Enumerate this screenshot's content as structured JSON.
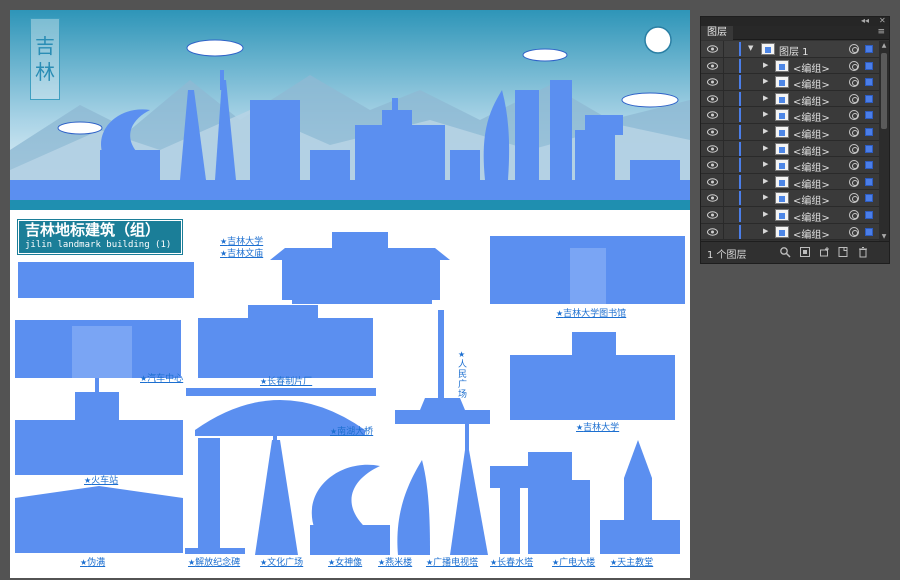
{
  "artboard": {
    "title_chars": [
      "吉",
      "林"
    ],
    "heading": "吉林地标建筑（组）",
    "subheading": "jilin landmark building (1)",
    "star": "★",
    "labels": {
      "jilin_university_a": "吉林大学",
      "jilin_confucius": "吉林文庙",
      "library": "吉林大学图书馆",
      "auto_center": "汽车中心",
      "film_studio": "长春制片厂",
      "people_square": "人民广场",
      "nanhu_bridge": "南湖大桥",
      "jilin_university_b": "吉林大学",
      "train_station": "火车站",
      "puppet_palace": "伪满",
      "liberation_monument": "解放纪念碑",
      "culture_square": "文化广场",
      "goddess_statue": "女神像",
      "yanmi_tower": "燕米楼",
      "tv_tower": "广播电视塔",
      "water_tower": "长春水塔",
      "power_building": "广电大楼",
      "catholic_church": "天主教堂"
    },
    "colors": {
      "building_blue": "#5b8ff0",
      "sky_top": "#2e95b8",
      "teal_strip": "#1f8fb0",
      "label_blue": "#1c6fd0"
    }
  },
  "layers_panel": {
    "tab_label": "图层",
    "collapse_glyph": "◂◂",
    "close_glyph": "✕",
    "menu_glyph": "≡",
    "top_layer": {
      "name": "图层 1"
    },
    "group_rows": [
      {
        "name": "<编组>"
      },
      {
        "name": "<编组>"
      },
      {
        "name": "<编组>"
      },
      {
        "name": "<编组>"
      },
      {
        "name": "<编组>"
      },
      {
        "name": "<编组>"
      },
      {
        "name": "<编组>"
      },
      {
        "name": "<编组>"
      },
      {
        "name": "<编组>"
      },
      {
        "name": "<编组>"
      },
      {
        "name": "<编组>"
      }
    ],
    "layer_count": "1 个图层",
    "footer_icons": [
      "search-icon",
      "make-clipping-mask-icon",
      "create-sublayer-icon",
      "new-layer-icon",
      "delete-icon"
    ],
    "scroll_arrows": {
      "up": "▲",
      "down": "▼"
    }
  }
}
